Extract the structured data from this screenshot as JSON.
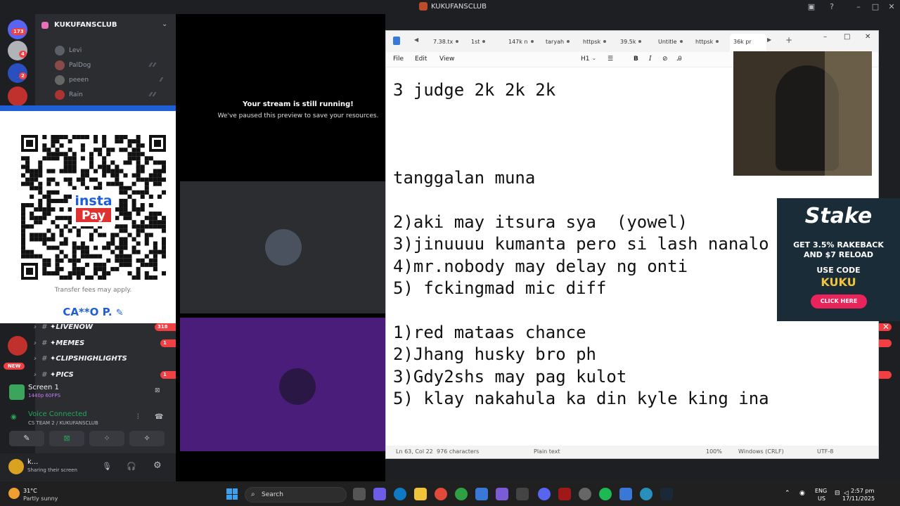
{
  "window": {
    "title": "KUKUFANSCLUB"
  },
  "server": {
    "name": "KUKUFANSCLUB",
    "rail_badges": [
      "173",
      "4",
      "2"
    ]
  },
  "voice_users": [
    "Levi",
    "PalDog",
    "peeen",
    "Rain"
  ],
  "qr_overlay": {
    "logo_top": "insta",
    "logo_bottom": "Pay",
    "fee_note": "Transfer fees may apply.",
    "account_name": "CA**O P."
  },
  "channels": [
    {
      "name": "✦LIVENOW",
      "badge": "318"
    },
    {
      "name": "✦MEMES",
      "badge": "1"
    },
    {
      "name": "✦CLIPSHIGHLIGHTS",
      "badge": ""
    },
    {
      "name": "✦PICS",
      "badge": "1"
    }
  ],
  "new_badge": "NEW",
  "stream_card": {
    "title": "Screen 1",
    "quality": "1440p 60FPS"
  },
  "voice_status": {
    "status": "Voice Connected",
    "channel": "CS TEAM 2 / KUKUFANSCLUB"
  },
  "user_panel": {
    "name": "k...",
    "status": "Sharing their screen"
  },
  "stream": {
    "title": "Your stream is still running!",
    "subtitle": "We've paused this preview to save your resources."
  },
  "notepad": {
    "tabs": [
      "7.38.tx",
      "1st",
      "147k n",
      "taryah",
      "httpsk",
      "39.5k",
      "Untitle",
      "httpsk",
      "36k pr"
    ],
    "menu": [
      "File",
      "Edit",
      "View"
    ],
    "format": {
      "heading": "H1"
    },
    "lines": [
      "3 judge 2k 2k 2k",
      "tanggalan muna",
      "2)aki may itsura sya  (yowel)",
      "3)jinuuuu kumanta pero si lash nanalo",
      "4)mr.nobody may delay ng onti",
      "5) fckingmad mic diff",
      "1)red mataas chance",
      "2)Jhang husky bro ph",
      "3)Gdy2shs may pag kulot",
      "5) klay nakahula ka din kyle king ina"
    ],
    "status": {
      "position": "Ln 63, Col 22",
      "chars": "976 characters",
      "type": "Plain text",
      "zoom": "100%",
      "eol": "Windows (CRLF)",
      "encoding": "UTF-8"
    }
  },
  "ad": {
    "brand": "Stake",
    "line1": "GET 3.5% RAKEBACK",
    "line2": "AND $7 RELOAD",
    "code_label": "USE CODE",
    "code": "KUKU",
    "cta": "CLICK HERE"
  },
  "taskbar": {
    "weather_temp": "31°C",
    "weather_desc": "Partly sunny",
    "search": "Search",
    "lang1": "ENG",
    "lang2": "US",
    "time": "2:57 pm",
    "date": "17/11/2025"
  },
  "colors": {
    "discord_bg": "#1e1f22",
    "accent_blue": "#1f5fd6",
    "stake_bg": "#1a2c38",
    "badge_red": "#f23f43"
  }
}
